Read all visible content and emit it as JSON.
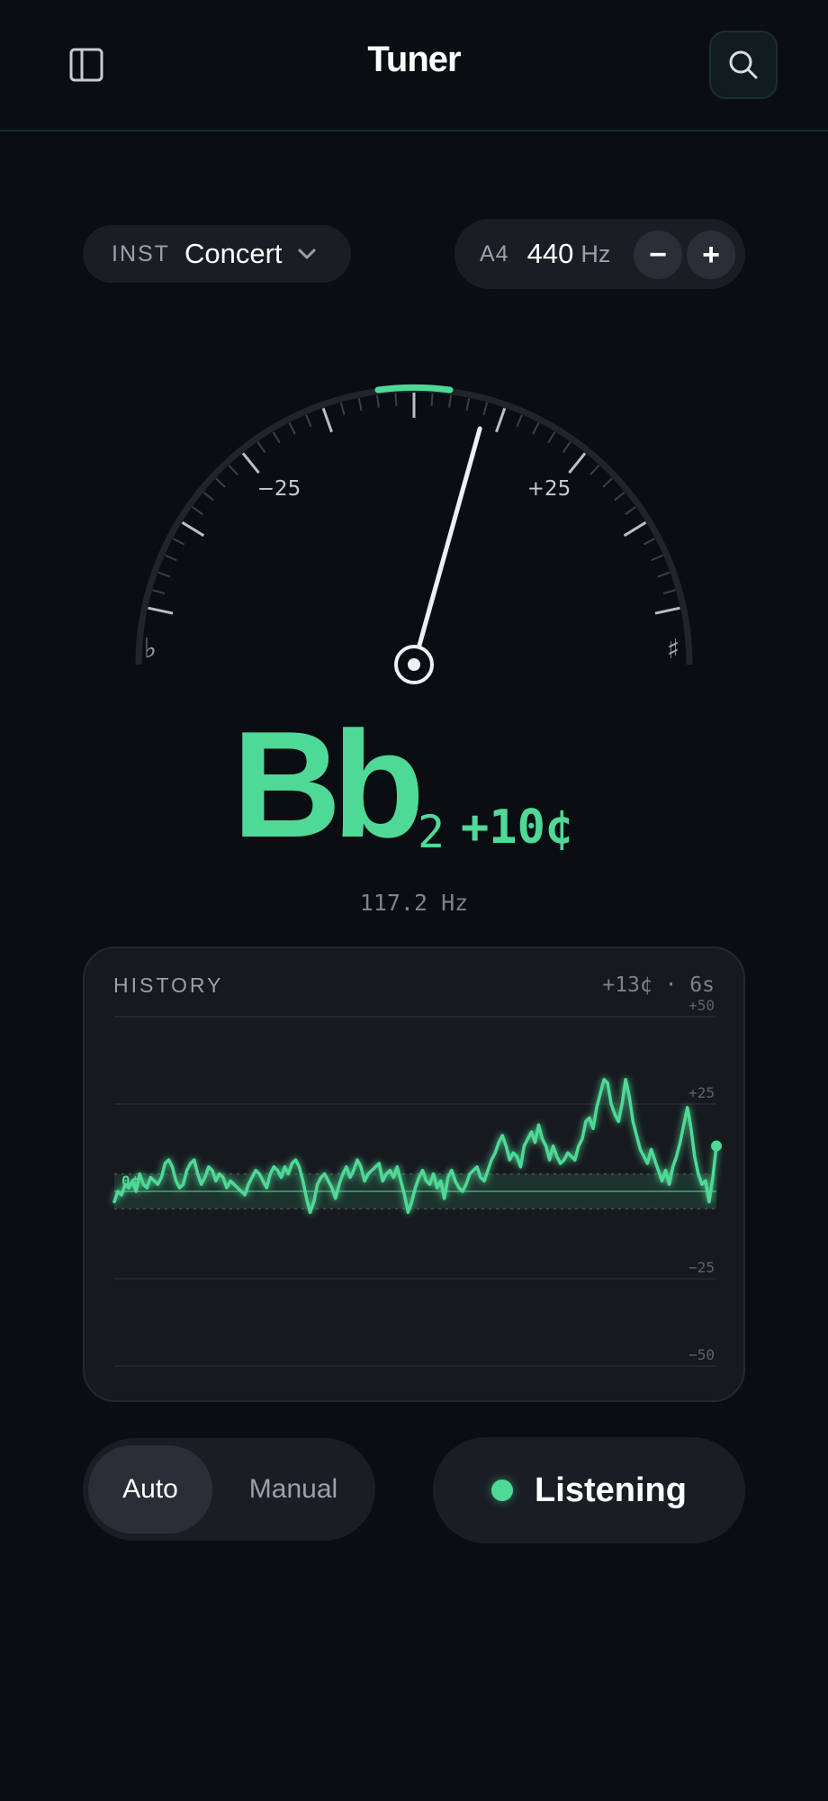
{
  "header": {
    "title": "Tuner",
    "sidebar_icon": "sidebar-icon",
    "search_icon": "search-icon"
  },
  "controls": {
    "instrument_label": "INST",
    "instrument_value": "Concert",
    "reference_label": "A4",
    "reference_value": "440",
    "reference_unit": "Hz",
    "minus_label": "−",
    "plus_label": "+"
  },
  "gauge": {
    "left_label": "−25",
    "right_label": "+25",
    "flat_symbol": "♭",
    "sharp_symbol": "♯",
    "needle_cents": 10,
    "range_cents": 50
  },
  "reading": {
    "note": "Bb",
    "octave": "2",
    "cents": "+10¢",
    "frequency": "117.2 Hz"
  },
  "history": {
    "title": "HISTORY",
    "meta": "+13¢ · 6s",
    "zero_label": "0¢",
    "y_labels": [
      "+50",
      "+25",
      "−25",
      "−50"
    ],
    "y_values": [
      50,
      25,
      -25,
      -50
    ],
    "ylim": [
      -50,
      50
    ],
    "in_tune_band": 5,
    "cents": [
      -3,
      0,
      -1,
      2,
      1,
      3,
      0,
      5,
      2,
      1,
      4,
      3,
      2,
      4,
      8,
      9,
      7,
      3,
      1,
      2,
      6,
      8,
      9,
      5,
      2,
      4,
      7,
      6,
      3,
      5,
      4,
      1,
      3,
      2,
      1,
      0,
      -1,
      2,
      4,
      6,
      5,
      3,
      1,
      5,
      7,
      6,
      4,
      7,
      5,
      8,
      9,
      7,
      3,
      -2,
      -6,
      -3,
      2,
      4,
      5,
      3,
      1,
      -2,
      2,
      5,
      7,
      4,
      6,
      9,
      7,
      3,
      5,
      6,
      7,
      8,
      3,
      5,
      6,
      4,
      7,
      3,
      -1,
      -6,
      -3,
      1,
      4,
      6,
      3,
      2,
      5,
      1,
      3,
      -2,
      4,
      6,
      3,
      1,
      0,
      2,
      5,
      6,
      7,
      4,
      3,
      6,
      9,
      11,
      14,
      16,
      13,
      9,
      11,
      10,
      7,
      13,
      15,
      17,
      14,
      19,
      15,
      13,
      9,
      13,
      10,
      8,
      9,
      11,
      10,
      9,
      13,
      15,
      20,
      21,
      18,
      24,
      28,
      32,
      31,
      25,
      22,
      20,
      25,
      32,
      27,
      20,
      16,
      12,
      10,
      8,
      12,
      9,
      6,
      3,
      6,
      2,
      7,
      10,
      14,
      19,
      24,
      18,
      10,
      5,
      2,
      3,
      -3,
      4,
      13
    ],
    "line_color": "#4fd997"
  },
  "mode": {
    "auto_label": "Auto",
    "manual_label": "Manual",
    "selected": "Auto"
  },
  "listen": {
    "label": "Listening",
    "status_color": "#4fd997"
  },
  "colors": {
    "background": "#0a0e13",
    "accent": "#4fd997",
    "surface": "#1a1e24"
  }
}
